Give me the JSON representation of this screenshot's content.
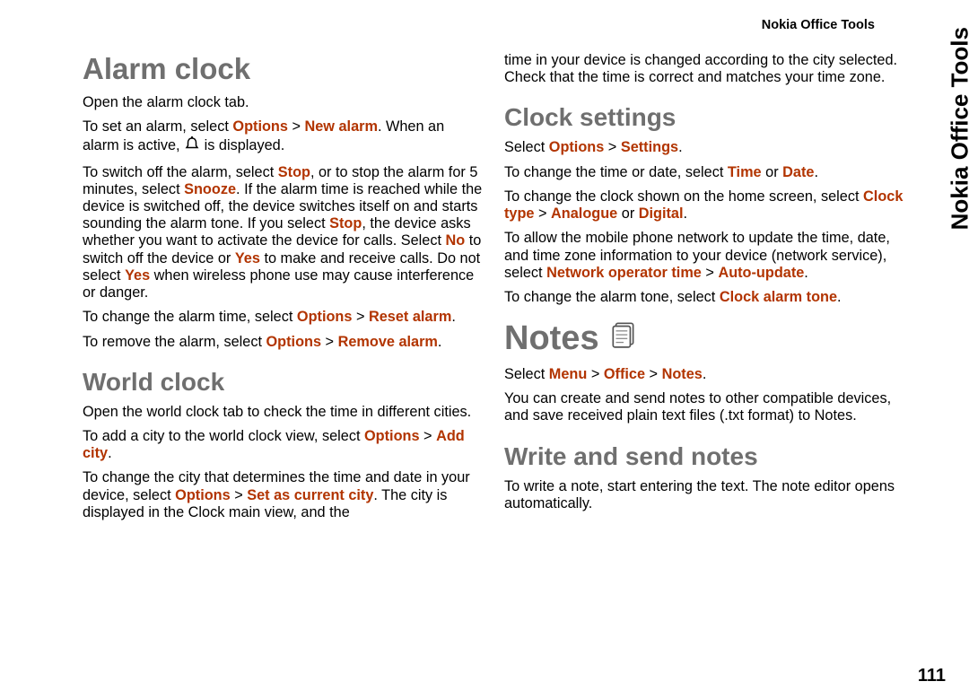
{
  "header": "Nokia Office Tools",
  "side_tab": "Nokia Office Tools",
  "page_number": "111",
  "left": {
    "h_alarm": "Alarm clock",
    "p1": "Open the alarm clock tab.",
    "p2a": "To set an alarm, select ",
    "p2_kw1": "Options",
    "p2_gt": " > ",
    "p2_kw2": "New alarm",
    "p2b": ". When an alarm is active, ",
    "p2c": " is displayed.",
    "p3a": "To switch off the alarm, select ",
    "p3_kw1": "Stop",
    "p3b": ", or to stop the alarm for 5 minutes, select ",
    "p3_kw2": "Snooze",
    "p3c": ". If the alarm time is reached while the device is switched off, the device switches itself on and starts sounding the alarm tone. If you select ",
    "p3_kw3": "Stop",
    "p3d": ", the device asks whether you want to activate the device for calls. Select ",
    "p3_kw4": "No",
    "p3e": " to switch off the device or ",
    "p3_kw5": "Yes",
    "p3f": " to make and receive calls. Do not select ",
    "p3_kw6": "Yes",
    "p3g": " when wireless phone use may cause interference or danger.",
    "p4a": "To change the alarm time, select ",
    "p4_kw1": "Options",
    "p4_gt": " > ",
    "p4_kw2": "Reset alarm",
    "p4b": ".",
    "p5a": "To remove the alarm, select ",
    "p5_kw1": "Options",
    "p5_gt": " > ",
    "p5_kw2": "Remove alarm",
    "p5b": ".",
    "h_world": "World clock",
    "p6": "Open the world clock tab to check the time in different cities.",
    "p7a": "To add a city to the world clock view, select ",
    "p7_kw1": "Options",
    "p7_gt": " > ",
    "p7_kw2": "Add city",
    "p7b": ".",
    "p8a": "To change the city that determines the time and date in your device, select ",
    "p8_kw1": "Options",
    "p8_gt": " > ",
    "p8_kw2": "Set as current city",
    "p8b": ". The city is displayed in the Clock main view, and the"
  },
  "right": {
    "p1": "time in your device is changed according to the city selected. Check that the time is correct and matches your time zone.",
    "h_clock": "Clock settings",
    "p2a": "Select ",
    "p2_kw1": "Options",
    "p2_gt": " > ",
    "p2_kw2": "Settings",
    "p2b": ".",
    "p3a": "To change the time or date, select ",
    "p3_kw1": "Time",
    "p3b": " or ",
    "p3_kw2": "Date",
    "p3c": ".",
    "p4a": "To change the clock shown on the home screen, select ",
    "p4_kw1": "Clock type",
    "p4_gt": " > ",
    "p4_kw2": "Analogue",
    "p4b": " or ",
    "p4_kw3": "Digital",
    "p4c": ".",
    "p5a": "To allow the mobile phone network to update the time, date, and time zone information to your device (network service), select ",
    "p5_kw1": "Network operator time",
    "p5_gt": " > ",
    "p5_kw2": "Auto-update",
    "p5b": ".",
    "p6a": "To change the alarm tone, select ",
    "p6_kw1": "Clock alarm tone",
    "p6b": ".",
    "h_notes": "Notes",
    "p7a": "Select ",
    "p7_kw1": "Menu",
    "p7_gt1": " > ",
    "p7_kw2": "Office",
    "p7_gt2": " > ",
    "p7_kw3": "Notes",
    "p7b": ".",
    "p8": "You can create and send notes to other compatible devices, and save received plain text files (.txt format) to Notes.",
    "h_write": "Write and send notes",
    "p9": "To write a note, start entering the text. The note editor opens automatically."
  }
}
